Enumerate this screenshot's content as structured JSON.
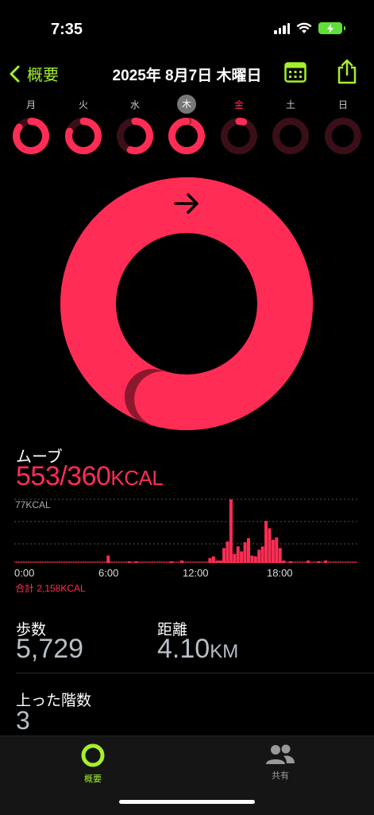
{
  "status_bar": {
    "time": "7:35"
  },
  "nav": {
    "back_label": "概要",
    "title": "2025年 8月7日 木曜日"
  },
  "week": [
    {
      "label": "月",
      "progress": 0.85,
      "state": "past"
    },
    {
      "label": "火",
      "progress": 0.8,
      "state": "past"
    },
    {
      "label": "水",
      "progress": 0.55,
      "state": "past"
    },
    {
      "label": "木",
      "progress": 1.54,
      "state": "today"
    },
    {
      "label": "金",
      "progress": 0.05,
      "state": "selected"
    },
    {
      "label": "土",
      "progress": 0.0,
      "state": "future"
    },
    {
      "label": "日",
      "progress": 0.0,
      "state": "future"
    }
  ],
  "colors": {
    "move": "#ff2d55",
    "accent": "#a6ef2d",
    "ring_track": "#3a0f18"
  },
  "move": {
    "label": "ムーブ",
    "value": "553/360",
    "unit": "KCAL",
    "progress": 1.54,
    "ymax_label": "77KCAL",
    "total": "合計 2,158KCAL"
  },
  "chart_data": {
    "type": "bar",
    "ylim": [
      0,
      77
    ],
    "xticks": [
      "0:00",
      "6:00",
      "12:00",
      "18:00"
    ],
    "values": [
      1,
      1,
      1,
      1,
      1,
      1,
      1,
      1,
      1,
      1,
      1,
      1,
      1,
      1,
      1,
      1,
      1,
      1,
      1,
      1,
      1,
      1,
      1,
      1,
      1,
      1,
      1,
      1,
      1,
      1,
      1,
      1,
      1,
      1,
      1,
      1,
      1,
      1,
      1,
      1,
      1,
      1,
      1,
      1,
      1,
      1,
      1,
      1,
      1,
      1,
      1,
      1,
      1,
      1,
      1,
      1,
      1,
      1,
      1,
      1,
      1,
      1,
      1,
      1,
      1,
      1,
      1,
      1,
      1,
      1,
      1,
      1,
      1,
      1,
      1,
      1,
      1,
      1,
      1,
      1,
      1,
      1,
      1,
      1,
      1,
      1,
      1,
      1,
      1,
      1,
      1,
      1,
      1,
      1,
      1,
      1,
      1,
      1,
      1,
      1,
      1,
      1,
      1,
      1,
      1,
      1,
      1,
      1,
      1,
      1,
      1,
      1,
      1,
      1,
      1,
      1,
      1,
      1,
      1,
      1,
      1,
      1,
      1,
      1,
      1,
      1,
      1,
      1,
      1,
      1,
      1,
      1,
      1,
      1,
      1,
      1,
      1,
      1,
      1,
      1,
      1,
      1,
      1,
      1,
      1,
      1,
      1,
      1,
      1,
      1,
      1,
      1,
      1,
      1,
      1,
      1,
      1,
      1,
      1,
      1,
      1,
      1,
      1,
      1,
      1,
      1,
      1,
      1,
      1,
      1,
      1,
      1,
      1,
      1,
      1,
      1,
      1,
      1,
      1,
      1,
      1,
      1,
      1,
      1,
      1,
      1,
      1,
      1,
      1,
      1,
      1,
      1,
      1,
      1,
      1,
      1,
      1,
      1,
      1,
      1,
      1,
      1,
      1,
      1,
      1,
      1,
      1,
      1,
      1,
      1,
      1,
      1,
      1,
      1,
      1,
      1,
      1,
      1,
      1,
      1,
      1,
      1,
      1,
      1,
      1,
      1,
      1,
      1,
      1,
      1,
      1,
      1,
      1,
      1,
      1,
      1,
      1,
      1,
      1,
      1,
      1,
      1,
      1,
      1,
      1,
      1,
      1,
      1,
      1,
      1,
      1,
      1,
      1,
      1,
      1,
      1,
      1,
      1,
      1,
      1,
      1,
      1,
      1,
      1,
      1,
      1,
      1,
      1,
      1,
      1,
      1,
      1,
      1,
      1,
      1,
      1,
      1,
      1,
      1,
      1,
      1,
      1,
      1,
      1,
      1,
      1,
      1,
      1
    ],
    "bars": [
      {
        "time": "6:35",
        "value": 9
      },
      {
        "time": "8:05",
        "value": 2
      },
      {
        "time": "8:35",
        "value": 2
      },
      {
        "time": "11:05",
        "value": 2
      },
      {
        "time": "11:50",
        "value": 3
      },
      {
        "time": "13:50",
        "value": 6
      },
      {
        "time": "14:05",
        "value": 8
      },
      {
        "time": "14:20",
        "value": 3
      },
      {
        "time": "14:35",
        "value": 3
      },
      {
        "time": "14:50",
        "value": 18
      },
      {
        "time": "15:05",
        "value": 26
      },
      {
        "time": "15:20",
        "value": 77
      },
      {
        "time": "15:35",
        "value": 11
      },
      {
        "time": "15:50",
        "value": 20
      },
      {
        "time": "16:05",
        "value": 14
      },
      {
        "time": "16:20",
        "value": 25
      },
      {
        "time": "16:35",
        "value": 30
      },
      {
        "time": "16:50",
        "value": 9
      },
      {
        "time": "17:05",
        "value": 8
      },
      {
        "time": "17:20",
        "value": 16
      },
      {
        "time": "17:35",
        "value": 20
      },
      {
        "time": "17:50",
        "value": 51
      },
      {
        "time": "18:05",
        "value": 42
      },
      {
        "time": "18:20",
        "value": 28
      },
      {
        "time": "18:35",
        "value": 31
      },
      {
        "time": "18:50",
        "value": 18
      },
      {
        "time": "19:05",
        "value": 3
      },
      {
        "time": "19:35",
        "value": 2
      },
      {
        "time": "20:50",
        "value": 3
      },
      {
        "time": "21:35",
        "value": 2
      },
      {
        "time": "22:05",
        "value": 3
      }
    ]
  },
  "steps": {
    "label": "歩数",
    "value": "5,729"
  },
  "distance": {
    "label": "距離",
    "value": "4.10",
    "unit": "KM"
  },
  "floors": {
    "label": "上った階数",
    "value": "3"
  },
  "tabbar": {
    "summary_label": "概要",
    "sharing_label": "共有"
  }
}
